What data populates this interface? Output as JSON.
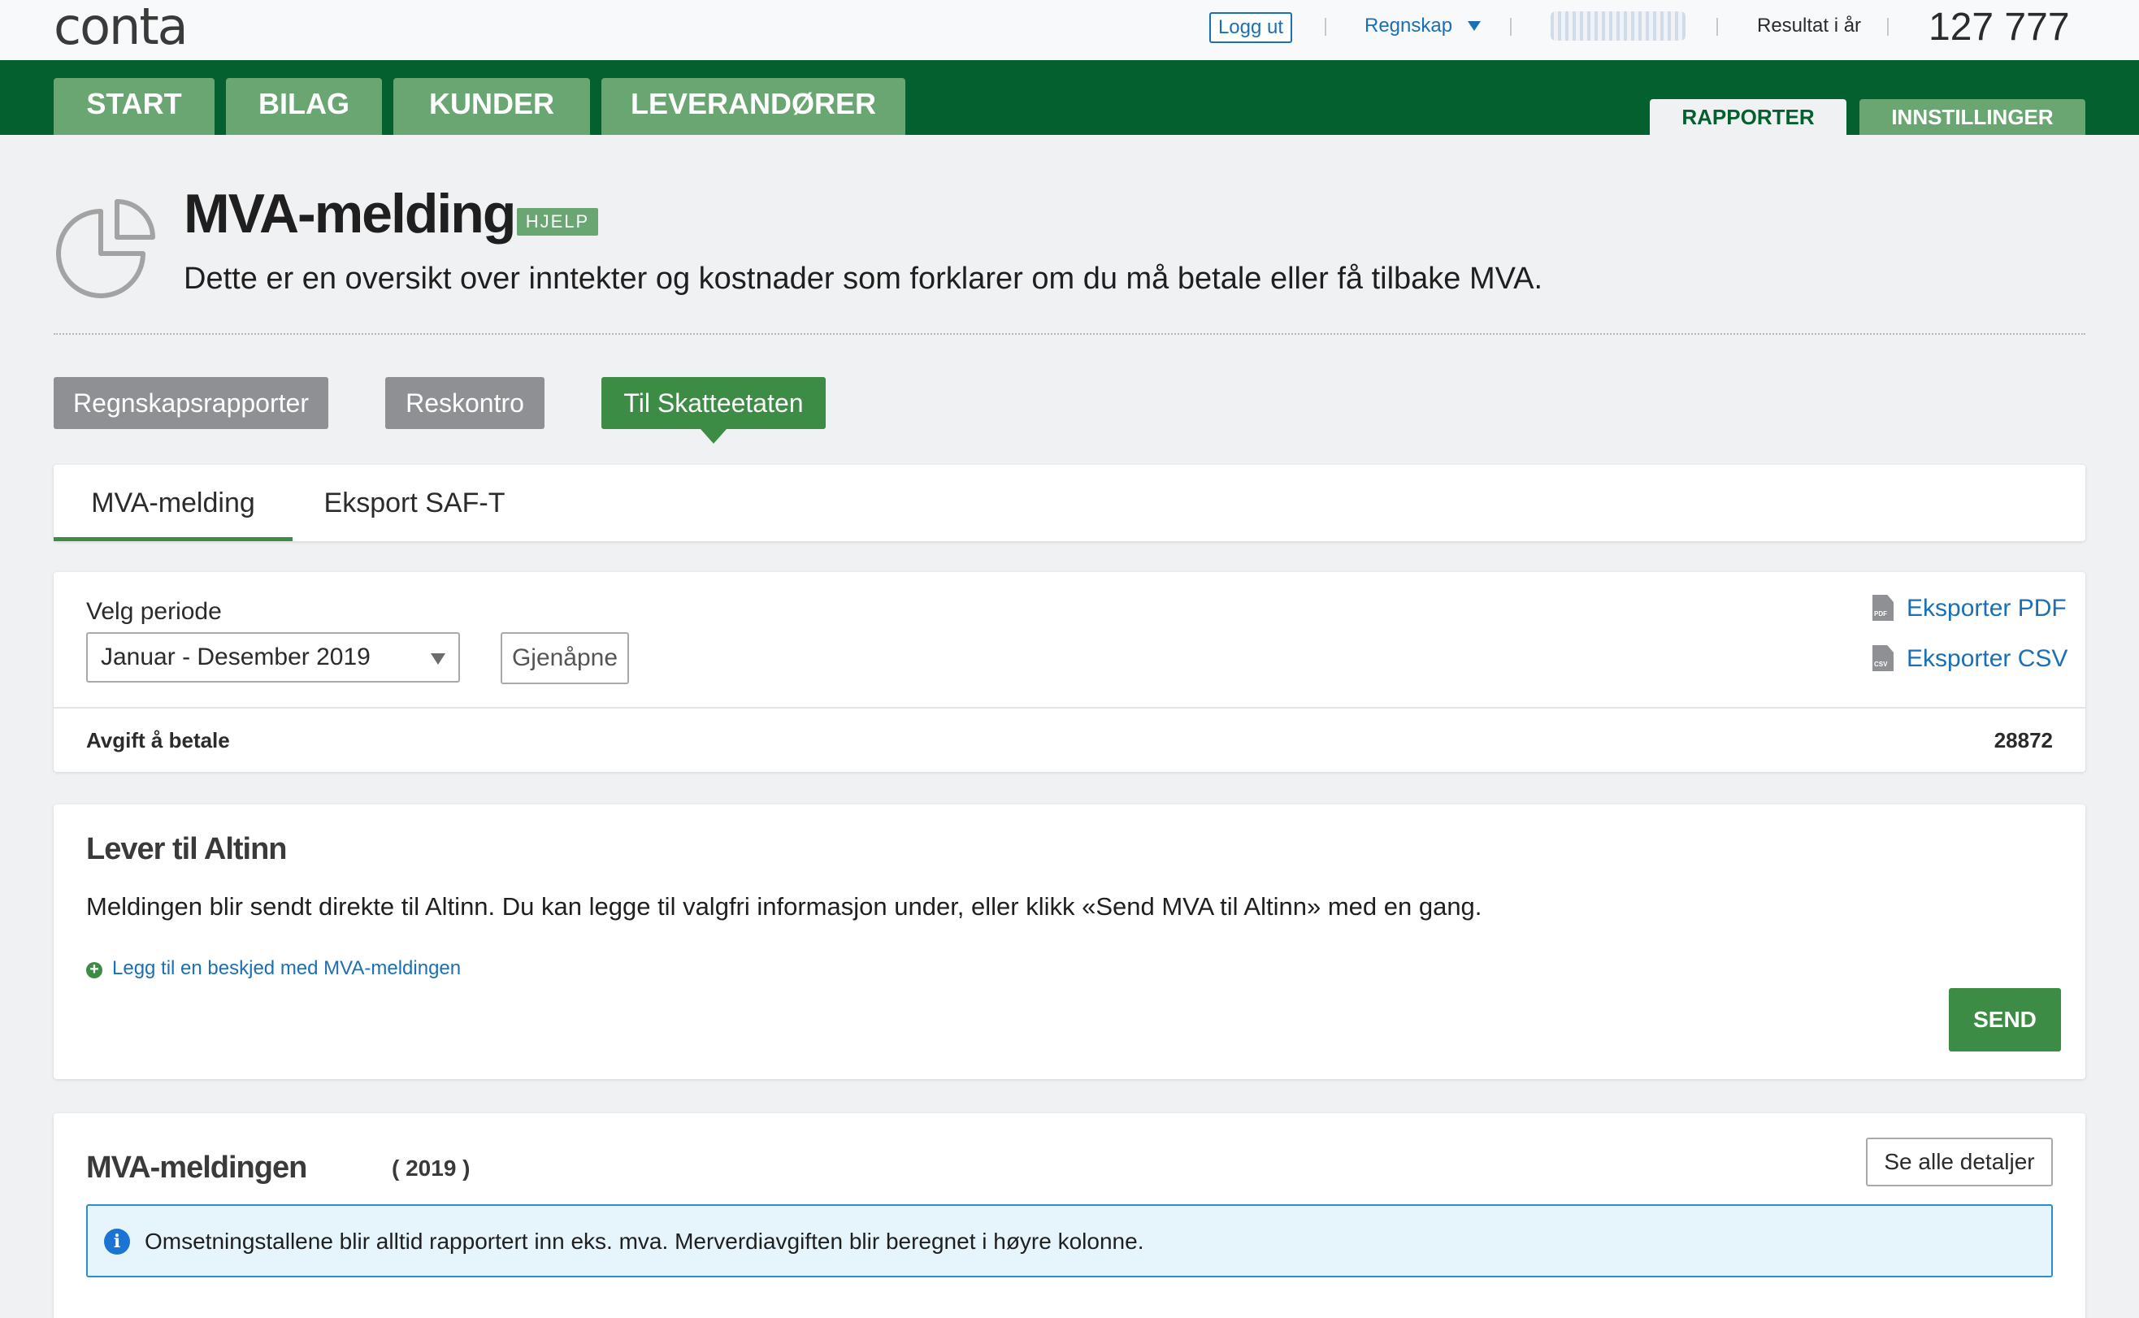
{
  "topbar": {
    "logo": "conta",
    "logout": "Logg ut",
    "regnskap": "Regnskap",
    "result_label": "Resultat i år",
    "result_value": "127 777"
  },
  "nav": {
    "tabs": [
      "START",
      "BILAG",
      "KUNDER",
      "LEVERANDØRER"
    ],
    "right_tabs": [
      "RAPPORTER",
      "INNSTILLINGER"
    ],
    "active_right": "RAPPORTER"
  },
  "header": {
    "title": "MVA-melding",
    "help": "HJELP",
    "subtitle": "Dette er en oversikt over inntekter og kostnader som forklarer om du må betale eller få tilbake MVA."
  },
  "report_buttons": [
    "Regnskapsrapporter",
    "Reskontro",
    "Til Skatteetaten"
  ],
  "active_report": "Til Skatteetaten",
  "sub_tabs": [
    "MVA-melding",
    "Eksport SAF-T"
  ],
  "active_sub_tab": "MVA-melding",
  "period": {
    "label": "Velg periode",
    "selected": "Januar - Desember 2019",
    "reopen": "Gjenåpne",
    "export_pdf": "Eksporter PDF",
    "export_csv": "Eksporter CSV",
    "pdf_icon_text": "PDF",
    "csv_icon_text": "CSV",
    "avgift_label": "Avgift å betale",
    "avgift_value": "28872"
  },
  "altinn": {
    "title": "Lever til Altinn",
    "text": "Meldingen blir sendt direkte til Altinn. Du kan legge til valgfri informasjon under, eller klikk «Send MVA til Altinn» med en gang.",
    "add_message": "Legg til en beskjed med MVA-meldingen",
    "send": "SEND"
  },
  "mva": {
    "title": "MVA-meldingen",
    "year": "( 2019 )",
    "details": "Se alle detaljer",
    "info": "Omsetningstallene blir alltid rapportert inn eks. mva. Merverdiavgiften blir beregnet i høyre kolonne."
  },
  "colors": {
    "brand_green": "#05602f",
    "tab_green": "#6aa671",
    "button_green": "#3c8c46",
    "link_blue": "#1b6fb5"
  }
}
